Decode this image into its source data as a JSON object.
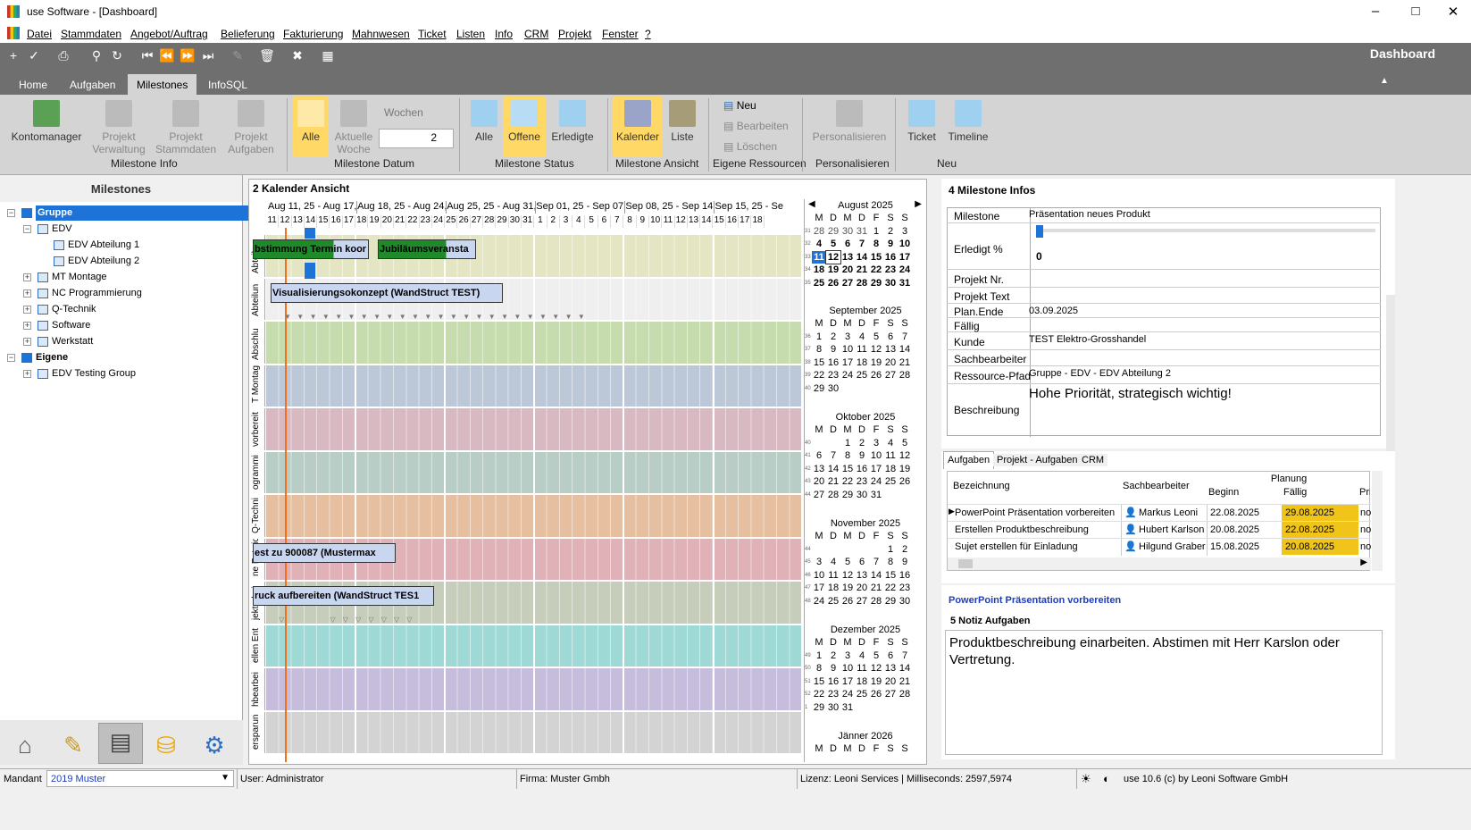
{
  "window": {
    "title": "use Software - [Dashboard]",
    "dashboard_label": "Dashboard"
  },
  "menu": [
    "Datei",
    "Stammdaten",
    "Angebot/Auftrag",
    "Belieferung",
    "Fakturierung",
    "Mahnwesen",
    "Ticket",
    "Listen",
    "Info",
    "CRM",
    "Projekt",
    "Fenster",
    "?"
  ],
  "ribbon_tabs": [
    "Home",
    "Aufgaben",
    "Milestones",
    "InfoSQL"
  ],
  "ribbon": {
    "kontomanager": "Kontomanager",
    "projekt_verwaltung": "Projekt Verwaltung",
    "projekt_stammdaten": "Projekt Stammdaten",
    "projekt_aufgaben": "Projekt Aufgaben",
    "grp_info": "Milestone Info",
    "alle_datum": "Alle",
    "aktuelle_woche": "Aktuelle Woche",
    "wochen": "Wochen",
    "wochen_value": "2",
    "grp_datum": "Milestone Datum",
    "alle_status": "Alle",
    "offene": "Offene",
    "erledigte": "Erledigte",
    "grp_status": "Milestone Status",
    "kalender": "Kalender",
    "liste": "Liste",
    "grp_ansicht": "Milestone Ansicht",
    "neu": "Neu",
    "bearbeiten": "Bearbeiten",
    "loeschen": "Löschen",
    "grp_eigene": "Eigene Ressourcen",
    "personalisieren": "Personalisieren",
    "grp_personalisieren": "Personalisieren",
    "ticket": "Ticket",
    "timeline": "Timeline",
    "grp_neu": "Neu"
  },
  "milestones": {
    "title": "Milestones",
    "tree": [
      {
        "label": "Gruppe",
        "level": 0,
        "bold": true,
        "selected": true
      },
      {
        "label": "EDV",
        "level": 1
      },
      {
        "label": "EDV Abteilung 1",
        "level": 2
      },
      {
        "label": "EDV Abteilung 2",
        "level": 2
      },
      {
        "label": "MT Montage",
        "level": 1
      },
      {
        "label": "NC Programmierung",
        "level": 1
      },
      {
        "label": "Q-Technik",
        "level": 1
      },
      {
        "label": "Software",
        "level": 1
      },
      {
        "label": "Werkstatt",
        "level": 1
      },
      {
        "label": "Eigene",
        "level": 0,
        "bold": true
      },
      {
        "label": "EDV Testing Group",
        "level": 1
      }
    ]
  },
  "calendar": {
    "title": "2 Kalender Ansicht",
    "weeks": [
      "Aug 11, 25 - Aug 17,",
      "Aug 18, 25 - Aug 24,",
      "Aug 25, 25 - Aug 31,",
      "Sep 01, 25 - Sep 07,",
      "Sep 08, 25 - Sep 14,",
      "Sep 15, 25 - Se"
    ],
    "days": [
      "11",
      "12",
      "13",
      "14",
      "15",
      "16",
      "17",
      "18",
      "19",
      "20",
      "21",
      "22",
      "23",
      "24",
      "25",
      "26",
      "27",
      "28",
      "29",
      "30",
      "31",
      "1",
      "2",
      "3",
      "4",
      "5",
      "6",
      "7",
      "8",
      "9",
      "10",
      "11",
      "12",
      "13",
      "14",
      "15",
      "16",
      "17",
      "18"
    ],
    "rows": [
      {
        "label": "Abteilur",
        "color": "#e4e6c3"
      },
      {
        "label": "Abteilun",
        "color": "#efefef"
      },
      {
        "label": "Abschlu",
        "color": "#c7dcae"
      },
      {
        "label": "T Montag",
        "color": "#bcc8d8"
      },
      {
        "label": "vorbereit",
        "color": "#d8b9c2"
      },
      {
        "label": "ogrammi",
        "color": "#b7cdc5"
      },
      {
        "label": "Q-Techni",
        "color": "#e6bfa0"
      },
      {
        "label": "ne Entwic",
        "color": "#e0b2b7"
      },
      {
        "label": "jektarbei",
        "color": "#c6cebb"
      },
      {
        "label": "ellen Ent",
        "color": "#9fd9d6"
      },
      {
        "label": "hbearbei",
        "color": "#c6bcdb"
      },
      {
        "label": "ersparun",
        "color": "#d3d3d3"
      }
    ],
    "events": [
      "bstimmung Termin koor",
      "Jubiläumsveransta",
      "Visualisierungsokonzept (WandStruct TEST)",
      "est zu 900087 (Mustermax",
      "ruck aufbereiten (WandStruct TES1"
    ]
  },
  "minical": {
    "dow": [
      "M",
      "D",
      "M",
      "D",
      "F",
      "S",
      "S"
    ],
    "months": [
      {
        "name": "August 2025",
        "weeks": [
          [
            "31",
            "28",
            "29",
            "30",
            "31",
            "1",
            "2",
            "3"
          ],
          [
            "32",
            "4",
            "5",
            "6",
            "7",
            "8",
            "9",
            "10"
          ],
          [
            "33",
            "11",
            "12",
            "13",
            "14",
            "15",
            "16",
            "17"
          ],
          [
            "34",
            "18",
            "19",
            "20",
            "21",
            "22",
            "23",
            "24"
          ],
          [
            "35",
            "25",
            "26",
            "27",
            "28",
            "29",
            "30",
            "31"
          ]
        ]
      },
      {
        "name": "September 2025",
        "weeks": [
          [
            "36",
            "1",
            "2",
            "3",
            "4",
            "5",
            "6",
            "7"
          ],
          [
            "37",
            "8",
            "9",
            "10",
            "11",
            "12",
            "13",
            "14"
          ],
          [
            "38",
            "15",
            "16",
            "17",
            "18",
            "19",
            "20",
            "21"
          ],
          [
            "39",
            "22",
            "23",
            "24",
            "25",
            "26",
            "27",
            "28"
          ],
          [
            "40",
            "29",
            "30",
            "",
            "",
            "",
            "",
            ""
          ]
        ]
      },
      {
        "name": "Oktober 2025",
        "weeks": [
          [
            "40",
            "",
            "",
            "1",
            "2",
            "3",
            "4",
            "5"
          ],
          [
            "41",
            "6",
            "7",
            "8",
            "9",
            "10",
            "11",
            "12"
          ],
          [
            "42",
            "13",
            "14",
            "15",
            "16",
            "17",
            "18",
            "19"
          ],
          [
            "43",
            "20",
            "21",
            "22",
            "23",
            "24",
            "25",
            "26"
          ],
          [
            "44",
            "27",
            "28",
            "29",
            "30",
            "31",
            "",
            ""
          ]
        ]
      },
      {
        "name": "November 2025",
        "weeks": [
          [
            "44",
            "",
            "",
            "",
            "",
            "",
            "1",
            "2"
          ],
          [
            "45",
            "3",
            "4",
            "5",
            "6",
            "7",
            "8",
            "9"
          ],
          [
            "46",
            "10",
            "11",
            "12",
            "13",
            "14",
            "15",
            "16"
          ],
          [
            "47",
            "17",
            "18",
            "19",
            "20",
            "21",
            "22",
            "23"
          ],
          [
            "48",
            "24",
            "25",
            "26",
            "27",
            "28",
            "29",
            "30"
          ]
        ]
      },
      {
        "name": "Dezember 2025",
        "weeks": [
          [
            "49",
            "1",
            "2",
            "3",
            "4",
            "5",
            "6",
            "7"
          ],
          [
            "50",
            "8",
            "9",
            "10",
            "11",
            "12",
            "13",
            "14"
          ],
          [
            "51",
            "15",
            "16",
            "17",
            "18",
            "19",
            "20",
            "21"
          ],
          [
            "52",
            "22",
            "23",
            "24",
            "25",
            "26",
            "27",
            "28"
          ],
          [
            "1",
            "29",
            "30",
            "31",
            "",
            "",
            "",
            ""
          ]
        ]
      },
      {
        "name": "Jänner 2026",
        "weeks": []
      }
    ]
  },
  "info": {
    "title": "4 Milestone Infos",
    "milestone_label": "Milestone",
    "milestone": "Präsentation neues Produkt",
    "erledigt_label": "Erledigt %",
    "erledigt": "0",
    "projekt_nr_label": "Projekt Nr.",
    "projekt_nr": "",
    "projekt_text_label": "Projekt Text",
    "projekt_text": "",
    "plan_ende_label": "Plan.Ende",
    "plan_ende": "03.09.2025",
    "faellig_label": "Fällig",
    "faellig": "",
    "kunde_label": "Kunde",
    "kunde": "TEST Elektro-Grosshandel",
    "sachbearbeiter_label": "Sachbearbeiter",
    "sachbearbeiter": "",
    "ressource_label": "Ressource-Pfad",
    "ressource": "Gruppe - EDV - EDV Abteilung 2",
    "beschreibung_label": "Beschreibung",
    "beschreibung": "Hohe Priorität, strategisch wichtig!"
  },
  "aufgaben": {
    "tabs": [
      "Aufgaben",
      "Projekt - Aufgaben",
      "CRM"
    ],
    "planung": "Planung",
    "cols": [
      "Bezeichnung",
      "Sachbearbeiter",
      "Beginn",
      "Fällig",
      "Prio"
    ],
    "rows": [
      {
        "bez": "PowerPoint Präsentation vorbereiten",
        "sb": "Markus Leoni",
        "beginn": "22.08.2025",
        "faellig": "29.08.2025",
        "prio": "nor"
      },
      {
        "bez": "Erstellen Produktbeschreibung",
        "sb": "Hubert Karlson",
        "beginn": "20.08.2025",
        "faellig": "22.08.2025",
        "prio": "nor"
      },
      {
        "bez": "Sujet erstellen für Einladung",
        "sb": "Hilgund Graber",
        "beginn": "15.08.2025",
        "faellig": "20.08.2025",
        "prio": "nor"
      }
    ]
  },
  "notiz": {
    "task_title": "PowerPoint Präsentation vorbereiten",
    "title": "5 Notiz Aufgaben",
    "text": "Produktbeschreibung einarbeiten. Abstimen mit Herr Karslon oder Vertretung."
  },
  "status": {
    "mandant_label": "Mandant",
    "mandant": "2019 Muster",
    "user": "User: Administrator",
    "firma": "Firma: Muster Gmbh",
    "lizenz": "Lizenz: Leoni Services | Milliseconds: 2597,5974",
    "version": "use 10.6 (c) by Leoni Software GmbH"
  },
  "colors": {
    "accent": "#1e73d8",
    "selected_yellow": "#ffd866",
    "event_green": "#1f8a2a",
    "faellig_yellow": "#f0c419"
  }
}
